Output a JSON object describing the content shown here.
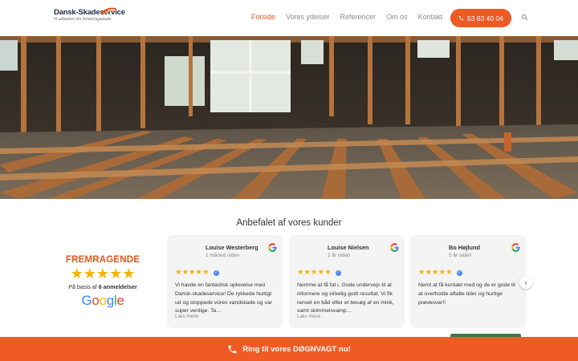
{
  "header": {
    "logo_text": "Dansk-Skadeservice",
    "logo_tagline": "Vi udbedrer din forsikringsskade",
    "nav": [
      {
        "label": "Forside",
        "active": true
      },
      {
        "label": "Vores ydelser",
        "active": false
      },
      {
        "label": "Referencer",
        "active": false
      },
      {
        "label": "Om os",
        "active": false
      },
      {
        "label": "Kontakt",
        "active": false
      }
    ],
    "phone_label": "53 83 40 04",
    "phone_icon": "phone-icon",
    "search_icon": "search-icon",
    "accent_color": "#ee5a24"
  },
  "hero": {
    "image_description": "renovation-floor-joists"
  },
  "reviews": {
    "section_title": "Anbefalet af vores kunder",
    "summary": {
      "rating_label": "FREMRAGENDE",
      "stars": "★★★★★",
      "basis_prefix": "På basis af",
      "basis_count": "6 anmeldelser",
      "brand": "Google"
    },
    "cards": [
      {
        "name": "Louise Westerberg",
        "date": "1 måned siden",
        "stars": "★★★★★",
        "text": "Vi havde en fantastisk oplevelse med Dansk-skadeservice! De rykkede hurtigt ud og stoppede vores vandskade og var super venlige. Ta…",
        "more": "Læs mere"
      },
      {
        "name": "Louise Nielsen",
        "date": "1 år siden",
        "stars": "★★★★★",
        "text": "Nemme at få fat i. Gode undervejs til at informere og virkelig godt resultat. Vi fik renset en båd efter et besøg af en mink, samt skimmelsvamp…",
        "more": "Læs mere"
      },
      {
        "name": "Bo Højlund",
        "date": "5 år siden",
        "stars": "★★★★★",
        "text": "Nemt at få kontakt med og de er gode til at overholde aftalte tider og hurtige prøvesvar!!",
        "more": ""
      }
    ],
    "next_arrow": "›"
  },
  "bottom_bar": {
    "label": "Ring til vores DØGNVAGT nu!",
    "icon": "phone-icon",
    "color": "#f05a24"
  }
}
